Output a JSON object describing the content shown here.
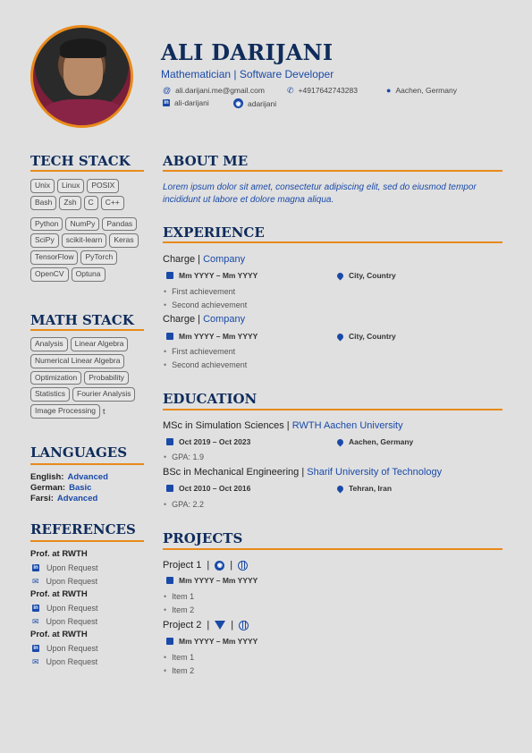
{
  "header": {
    "name": "ALI DARIJANI",
    "subtitle": "Mathematician | Software Developer",
    "email": "ali.darijani.me@gmail.com",
    "phone": "+4917642743283",
    "location": "Aachen, Germany",
    "linkedin": "ali-darijani",
    "github": "adarijani"
  },
  "sections": {
    "tech": "TECH STACK",
    "math": "MATH STACK",
    "languages": "LANGUAGES",
    "references": "REFERENCES",
    "about": "ABOUT ME",
    "experience": "EXPERIENCE",
    "education": "EDUCATION",
    "projects": "PROJECTS"
  },
  "tech_stack": [
    [
      "Unix",
      "Linux",
      "POSIX"
    ],
    [
      "Bash",
      "Zsh",
      "C",
      "C++"
    ],
    [
      "Python",
      "NumPy",
      "Pandas"
    ],
    [
      "SciPy",
      "scikit-learn",
      "Keras"
    ],
    [
      "TensorFlow",
      "PyTorch"
    ],
    [
      "OpenCV",
      "Optuna"
    ]
  ],
  "math_stack": [
    [
      "Analysis",
      "Linear Algebra"
    ],
    [
      "Numerical Linear Algebra"
    ],
    [
      "Optimization",
      "Probability"
    ],
    [
      "Statistics",
      "Fourier Analysis"
    ],
    [
      "Image Processing"
    ]
  ],
  "math_trailing": "t",
  "languages": [
    {
      "label": "English:",
      "level": "Advanced"
    },
    {
      "label": "German:",
      "level": "Basic"
    },
    {
      "label": "Farsi:",
      "level": "Advanced"
    }
  ],
  "references": [
    {
      "name": "Prof. at RWTH",
      "linkedin": "Upon Request",
      "email": "Upon Request"
    },
    {
      "name": "Prof. at RWTH",
      "linkedin": "Upon Request",
      "email": "Upon Request"
    },
    {
      "name": "Prof. at RWTH",
      "linkedin": "Upon Request",
      "email": "Upon Request"
    }
  ],
  "about": "Lorem ipsum dolor sit amet, consectetur adipiscing elit, sed do eiusmod tempor incididunt ut labore et dolore magna aliqua.",
  "experience": [
    {
      "role": "Charge",
      "sep": "|",
      "org": "Company",
      "dates": "Mm YYYY – Mm YYYY",
      "place": "City, Country",
      "items": [
        "First achievement",
        "Second achievement"
      ]
    },
    {
      "role": "Charge",
      "sep": "|",
      "org": "Company",
      "dates": "Mm YYYY – Mm YYYY",
      "place": "City, Country",
      "items": [
        "First achievement",
        "Second achievement"
      ]
    }
  ],
  "education": [
    {
      "degree": "MSc in Simulation Sciences",
      "sep": "|",
      "org": "RWTH Aachen University",
      "dates": "Oct 2019 – Oct 2023",
      "place": "Aachen, Germany",
      "gpa": "GPA: 1.9"
    },
    {
      "degree": "BSc in Mechanical Engineering",
      "sep": "|",
      "org": "Sharif University of Technology",
      "dates": "Oct 2010 – Oct 2016",
      "place": "Tehran, Iran",
      "gpa": "GPA: 2.2"
    }
  ],
  "projects": [
    {
      "title": "Project 1",
      "sep": "|",
      "dates": "Mm YYYY – Mm YYYY",
      "items": [
        "Item 1",
        "Item 2"
      ],
      "repo_icon": "github-icon"
    },
    {
      "title": "Project 2",
      "sep": "|",
      "dates": "Mm YYYY – Mm YYYY",
      "items": [
        "Item 1",
        "Item 2"
      ],
      "repo_icon": "gitlab-icon"
    }
  ],
  "colors": {
    "accent": "#e88a1a",
    "navy": "#0f2c5b",
    "blue": "#1a4aa8",
    "background": "#e0e0e0"
  }
}
